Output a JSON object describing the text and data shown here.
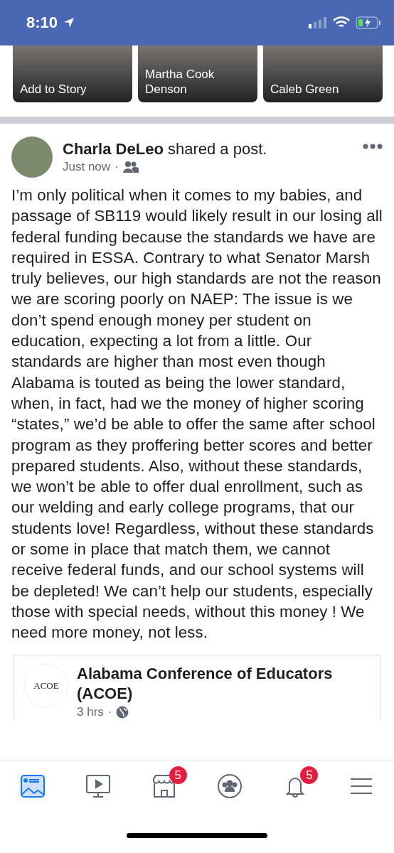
{
  "status_bar": {
    "time": "8:10"
  },
  "stories": [
    {
      "name": "Add to Story"
    },
    {
      "name": "Martha Cook Denson"
    },
    {
      "name": "Caleb Green"
    }
  ],
  "post": {
    "author": "Charla DeLeo",
    "action": "shared a post.",
    "time": "Just now",
    "separator": "·",
    "body": "I’m only political when it comes to my babies, and passage of SB119 would likely result in our losing all federal funding because the standards we have are required in ESSA. Contrary to what Senator Marsh truly believes, our high standards are not the reason we are scoring poorly on NAEP: The issue is we don’t spend enough money per student on education, expecting a lot from a little. Our standards are higher than most even though Alabama is touted as being the lower standard, when, in fact, had we the money of higher scoring “states,” we’d be able to offer the same after school program as they proffering better scores and better prepared students. Also, without these standards, we won’t be able to offer dual enrollment, such as our welding and early college programs, that our students love! Regardless, without these standards or some in place that match them, we cannot receive federal funds, and our school systems will be depleted! We can’t help our students, especially those with special needs, without this money ! We need more money, not less.",
    "shared": {
      "logo_text": "ACOE",
      "page": "Alabama Conference of Educators (ACOE)",
      "time": "3 hrs",
      "separator": "·"
    }
  },
  "tab_bar": [
    {
      "kind": "feed",
      "selected": true
    },
    {
      "kind": "video",
      "selected": false
    },
    {
      "kind": "marketplace",
      "selected": false,
      "badge": "5"
    },
    {
      "kind": "groups",
      "selected": false
    },
    {
      "kind": "notifications",
      "selected": false,
      "badge": "5"
    },
    {
      "kind": "menu",
      "selected": false
    }
  ]
}
